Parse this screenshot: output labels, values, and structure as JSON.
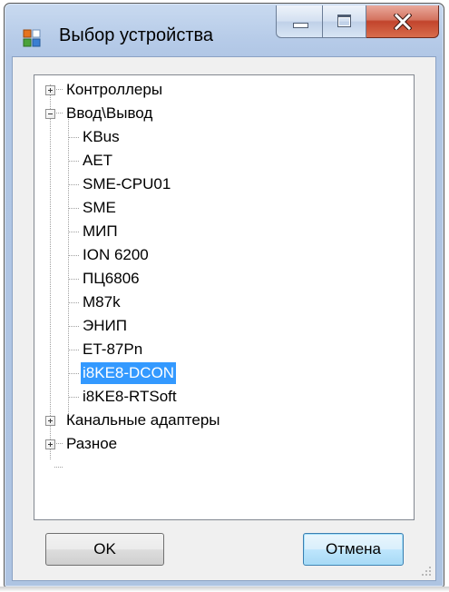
{
  "window": {
    "title": "Выбор устройства"
  },
  "tree": {
    "root_items": [
      {
        "label": "Контроллеры",
        "expanded": false
      },
      {
        "label": "Ввод\\Вывод",
        "expanded": true
      },
      {
        "label": "Канальные адаптеры",
        "expanded": false
      },
      {
        "label": "Разное",
        "expanded": false
      }
    ],
    "io_children": [
      {
        "label": "KBus"
      },
      {
        "label": "AET"
      },
      {
        "label": "SME-CPU01"
      },
      {
        "label": "SME"
      },
      {
        "label": "МИП"
      },
      {
        "label": "ION 6200"
      },
      {
        "label": "ПЦ6806"
      },
      {
        "label": "M87k"
      },
      {
        "label": "ЭНИП"
      },
      {
        "label": "ET-87Pn"
      },
      {
        "label": "i8KE8-DCON",
        "selected": true
      },
      {
        "label": "i8KE8-RTSoft"
      }
    ]
  },
  "buttons": {
    "ok_label": "OK",
    "cancel_label": "Отмена"
  },
  "colors": {
    "selection": "#3399ff",
    "close_button": "#c2442c"
  }
}
